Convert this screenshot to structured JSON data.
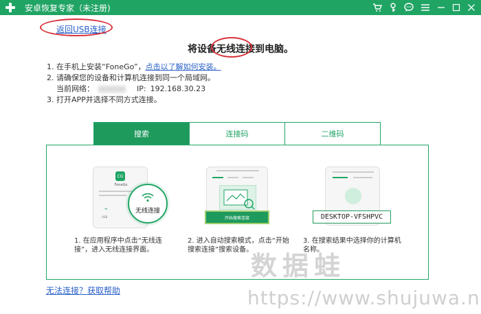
{
  "window": {
    "title": "安卓恢复专家（未注册)",
    "icons": [
      "cart-icon",
      "key-icon",
      "chat-icon",
      "menu-icon",
      "minimize-icon",
      "maximize-icon",
      "close-icon"
    ]
  },
  "back_link": "返回USB连接",
  "heading": "将设备无线连接到电脑。",
  "steps": {
    "s1_prefix": "在手机上安装“FoneGo”，",
    "s1_link": "点击以了解如何安装。",
    "s2": "请确保您的设备和计算机连接到同一个局域网。",
    "network_label": "当前网络：",
    "ip_label": "IP:",
    "ip_value": "192.168.30.23",
    "s3": "打开APP并选择不同方式连接。"
  },
  "tabs": [
    {
      "label": "搜索",
      "active": true
    },
    {
      "label": "连接码",
      "active": false
    },
    {
      "label": "二维码",
      "active": false
    }
  ],
  "illustrations": {
    "app_name": "FoneGo",
    "wifi_label": "无线连接",
    "start_search_button": "开始搜索连接",
    "device_name": "DESKTOP-VFSHPVC"
  },
  "captions": [
    "1. 在应用程序中点击“无线连接”，进入无线连接界面。",
    "2. 进入自动搜索模式，点击“开始搜索连接”搜索设备。",
    "3. 在搜索结果中选择你的计算机名称。"
  ],
  "help_link": "无法连接？获取帮助",
  "watermark": {
    "cn": "数据蛙",
    "url": "https://www.shujuwa.net"
  },
  "colors": {
    "brand_green": "#20a464",
    "link_blue": "#2a60c8",
    "annotation_red": "#d9303a"
  }
}
